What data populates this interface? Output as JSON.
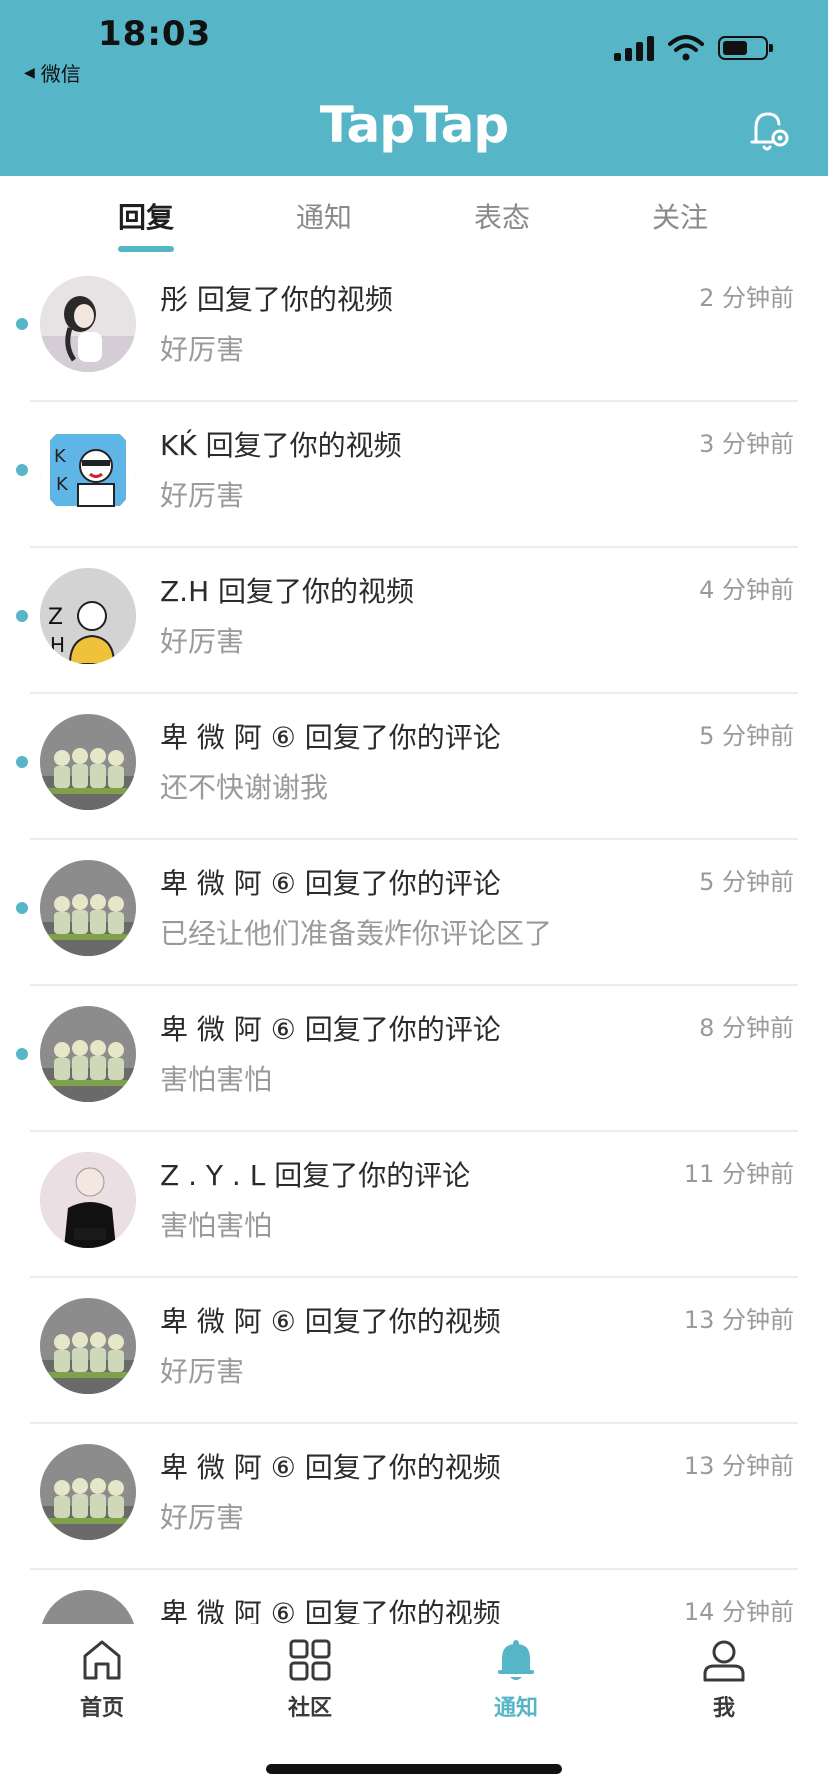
{
  "status_bar": {
    "time": "18:03",
    "back_app": "微信"
  },
  "header": {
    "title": "TapTap"
  },
  "tabs": [
    {
      "label": "回复",
      "active": true
    },
    {
      "label": "通知",
      "active": false
    },
    {
      "label": "表态",
      "active": false
    },
    {
      "label": "关注",
      "active": false
    }
  ],
  "notifications": [
    {
      "title": "彤 回复了你的视频",
      "content": "好厉害",
      "time": "2 分钟前",
      "unread": true,
      "avatar": "girl-photo-avatar"
    },
    {
      "title": "KḰ 回复了你的视频",
      "content": "好厉害",
      "time": "3 分钟前",
      "unread": true,
      "avatar": "cartoon-sketch-avatar"
    },
    {
      "title": "Z.H 回复了你的视频",
      "content": "好厉害",
      "time": "4 分钟前",
      "unread": true,
      "avatar": "cartoon-yellow-shirt-avatar"
    },
    {
      "title": "卑 微 阿 ⑥ 回复了你的评论",
      "content": "还不快谢谢我",
      "time": "5 分钟前",
      "unread": true,
      "avatar": "figures-group-avatar"
    },
    {
      "title": "卑 微 阿 ⑥ 回复了你的评论",
      "content": "已经让他们准备轰炸你评论区了",
      "time": "5 分钟前",
      "unread": true,
      "avatar": "figures-group-avatar"
    },
    {
      "title": "卑 微 阿 ⑥ 回复了你的评论",
      "content": "害怕害怕",
      "time": "8 分钟前",
      "unread": true,
      "avatar": "figures-group-avatar"
    },
    {
      "title": "Z . Y . L 回复了你的评论",
      "content": "害怕害怕",
      "time": "11 分钟前",
      "unread": false,
      "avatar": "doll-avatar"
    },
    {
      "title": "卑 微 阿 ⑥ 回复了你的视频",
      "content": "好厉害",
      "time": "13 分钟前",
      "unread": false,
      "avatar": "figures-group-avatar"
    },
    {
      "title": "卑 微 阿 ⑥ 回复了你的视频",
      "content": "好厉害",
      "time": "13 分钟前",
      "unread": false,
      "avatar": "figures-group-avatar"
    },
    {
      "title": "卑 微 阿 ⑥ 回复了你的视频",
      "content": "",
      "time": "14 分钟前",
      "unread": false,
      "avatar": "figures-group-avatar"
    }
  ],
  "bottom_nav": [
    {
      "label": "首页",
      "icon": "home-icon",
      "active": false
    },
    {
      "label": "社区",
      "icon": "grid-icon",
      "active": false
    },
    {
      "label": "通知",
      "icon": "bell-icon",
      "active": true
    },
    {
      "label": "我",
      "icon": "profile-icon",
      "active": false
    }
  ],
  "colors": {
    "accent": "#57b5c8",
    "header_bg": "#57b5c8",
    "unread_dot": "#57b5c8"
  }
}
